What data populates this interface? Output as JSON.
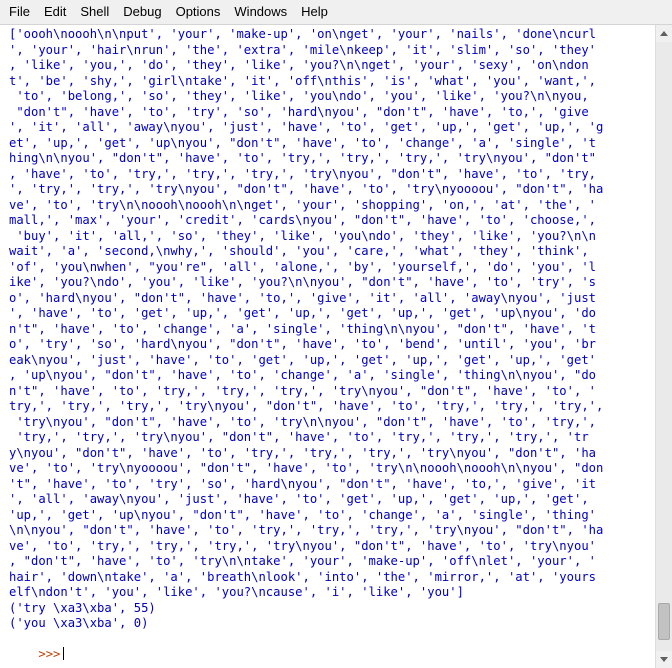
{
  "menu": [
    "File",
    "Edit",
    "Shell",
    "Debug",
    "Options",
    "Windows",
    "Help"
  ],
  "output_lines": [
    "['oooh\\noooh\\n\\nput', 'your', 'make-up', 'on\\nget', 'your', 'nails', 'done\\ncurl",
    "', 'your', 'hair\\nrun', 'the', 'extra', 'mile\\nkeep', 'it', 'slim', 'so', 'they'",
    ", 'like', 'you,', 'do', 'they', 'like', 'you?\\n\\nget', 'your', 'sexy', 'on\\ndon",
    "t', 'be', 'shy,', 'girl\\ntake', 'it', 'off\\nthis', 'is', 'what', 'you', 'want,',",
    " 'to', 'belong,', 'so', 'they', 'like', 'you\\ndo', 'you', 'like', 'you?\\n\\nyou,",
    " \"don't\", 'have', 'to', 'try', 'so', 'hard\\nyou', \"don't\", 'have', 'to,', 'give",
    "', 'it', 'all', 'away\\nyou', 'just', 'have', 'to', 'get', 'up,', 'get', 'up,', 'g",
    "et', 'up,', 'get', 'up\\nyou', \"don't\", 'have', 'to', 'change', 'a', 'single', 't",
    "hing\\n\\nyou', \"don't\", 'have', 'to', 'try,', 'try,', 'try,', 'try\\nyou', \"don't\"",
    ", 'have', 'to', 'try,', 'try,', 'try,', 'try\\nyou', \"don't\", 'have', 'to', 'try,",
    "', 'try,', 'try,', 'try\\nyou', \"don't\", 'have', 'to', 'try\\nyoooou', \"don't\", 'ha",
    "ve', 'to', 'try\\n\\noooh\\noooh\\n\\nget', 'your', 'shopping', 'on,', 'at', 'the', '",
    "mall,', 'max', 'your', 'credit', 'cards\\nyou', \"don't\", 'have', 'to', 'choose,',",
    " 'buy', 'it', 'all,', 'so', 'they', 'like', 'you\\ndo', 'they', 'like', 'you?\\n\\n",
    "wait', 'a', 'second,\\nwhy,', 'should', 'you', 'care,', 'what', 'they', 'think',",
    "'of', 'you\\nwhen', \"you're\", 'all', 'alone,', 'by', 'yourself,', 'do', 'you', 'l",
    "ike', 'you?\\ndo', 'you', 'like', 'you?\\n\\nyou', \"don't\", 'have', 'to', 'try', 's",
    "o', 'hard\\nyou', \"don't\", 'have', 'to,', 'give', 'it', 'all', 'away\\nyou', 'just",
    "', 'have', 'to', 'get', 'up,', 'get', 'up,', 'get', 'up,', 'get', 'up\\nyou', 'do",
    "n't\", 'have', 'to', 'change', 'a', 'single', 'thing\\n\\nyou', \"don't\", 'have', 't",
    "o', 'try', 'so', 'hard\\nyou', \"don't\", 'have', 'to', 'bend', 'until', 'you', 'br",
    "eak\\nyou', 'just', 'have', 'to', 'get', 'up,', 'get', 'up,', 'get', 'up,', 'get'",
    ", 'up\\nyou', \"don't\", 'have', 'to', 'change', 'a', 'single', 'thing\\n\\nyou', \"do",
    "n't\", 'have', 'to', 'try,', 'try,', 'try,', 'try\\nyou', \"don't\", 'have', 'to', '",
    "try,', 'try,', 'try,', 'try\\nyou', \"don't\", 'have', 'to', 'try,', 'try,', 'try,',",
    " 'try\\nyou', \"don't\", 'have', 'to', 'try\\n\\nyou', \"don't\", 'have', 'to', 'try,',",
    " 'try,', 'try,', 'try\\nyou', \"don't\", 'have', 'to', 'try,', 'try,', 'try,', 'tr",
    "y\\nyou', \"don't\", 'have', 'to', 'try,', 'try,', 'try,', 'try\\nyou', \"don't\", 'ha",
    "ve', 'to', 'try\\nyoooou', \"don't\", 'have', 'to', 'try\\n\\noooh\\noooh\\n\\nyou', \"don",
    "'t\", 'have', 'to', 'try', 'so', 'hard\\nyou', \"don't\", 'have', 'to,', 'give', 'it",
    "', 'all', 'away\\nyou', 'just', 'have', 'to', 'get', 'up,', 'get', 'up,', 'get',",
    "'up,', 'get', 'up\\nyou', \"don't\", 'have', 'to', 'change', 'a', 'single', 'thing'",
    "\\n\\nyou', \"don't\", 'have', 'to', 'try,', 'try,', 'try,', 'try\\nyou', \"don't\", 'ha",
    "ve', 'to', 'try,', 'try,', 'try,', 'try\\nyou', \"don't\", 'have', 'to', 'try\\nyou'",
    ", \"don't\", 'have', 'to', 'try\\n\\ntake', 'your', 'make-up', 'off\\nlet', 'your', '",
    "hair', 'down\\ntake', 'a', 'breath\\nlook', 'into', 'the', 'mirror,', 'at', 'yours",
    "elf\\ndon't', 'you', 'like', 'you?\\ncause', 'i', 'like', 'you']",
    "('try \\xa3\\xba', 55)",
    "('you \\xa3\\xba', 0)"
  ],
  "prompt": ">>>",
  "scrollbar": {
    "position_fraction": 0.98,
    "visible_fraction": 0.06
  }
}
